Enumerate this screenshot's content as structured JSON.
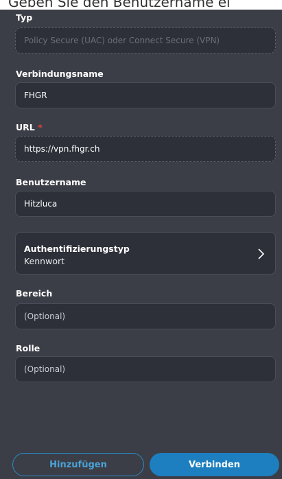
{
  "header": {
    "partial_text": "Geben Sie den Benutzername ei"
  },
  "form": {
    "type": {
      "label": "Typ",
      "value": "Policy Secure (UAC) oder Connect Secure (VPN)"
    },
    "connection_name": {
      "label": "Verbindungsname",
      "value": "FHGR"
    },
    "url": {
      "label": "URL",
      "required_marker": "*",
      "value": "https://vpn.fhgr.ch"
    },
    "username": {
      "label": "Benutzername",
      "value": "Hitzluca"
    },
    "auth": {
      "title": "Authentifizierungstyp",
      "value": "Kennwort",
      "icon": "chevron-right-icon"
    },
    "realm": {
      "label": "Bereich",
      "placeholder": "(Optional)"
    },
    "role": {
      "label": "Rolle",
      "placeholder": "(Optional)"
    }
  },
  "footer": {
    "add_label": "Hinzufügen",
    "connect_label": "Verbinden"
  },
  "colors": {
    "background": "#3b3e47",
    "field": "#2d3039",
    "accent": "#1d7fbf",
    "required": "#e0413a"
  }
}
